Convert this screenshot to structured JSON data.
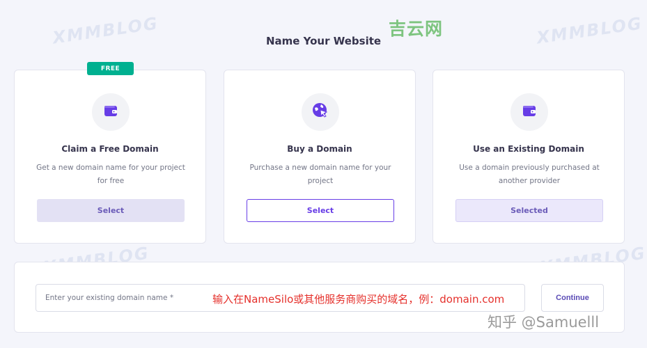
{
  "page": {
    "title": "Name Your Website"
  },
  "brand_mark": "吉云网",
  "watermark_text": "XMMBLOG",
  "cards": [
    {
      "badge": "FREE",
      "icon": "wallet-icon",
      "title": "Claim a Free Domain",
      "description": "Get a new domain name for your project for free",
      "button_label": "Select",
      "button_state": "default"
    },
    {
      "icon": "globe-cursor-icon",
      "title": "Buy a Domain",
      "description": "Purchase a new domain name for your project",
      "button_label": "Select",
      "button_state": "outline"
    },
    {
      "icon": "wallet-icon",
      "title": "Use an Existing Domain",
      "description": "Use a domain previously purchased at another provider",
      "button_label": "Selected",
      "button_state": "selected"
    }
  ],
  "domain_form": {
    "placeholder": "Enter your existing domain name *",
    "value": "",
    "annotation": "输入在NameSilo或其他服务商购买的域名，例：domain.com",
    "continue_label": "Continue"
  },
  "credit": "知乎 @Samuelll",
  "colors": {
    "accent": "#673de6",
    "badge_green": "#00b090",
    "annotation_red": "#e5302b",
    "brand_green": "#7dc47f"
  }
}
